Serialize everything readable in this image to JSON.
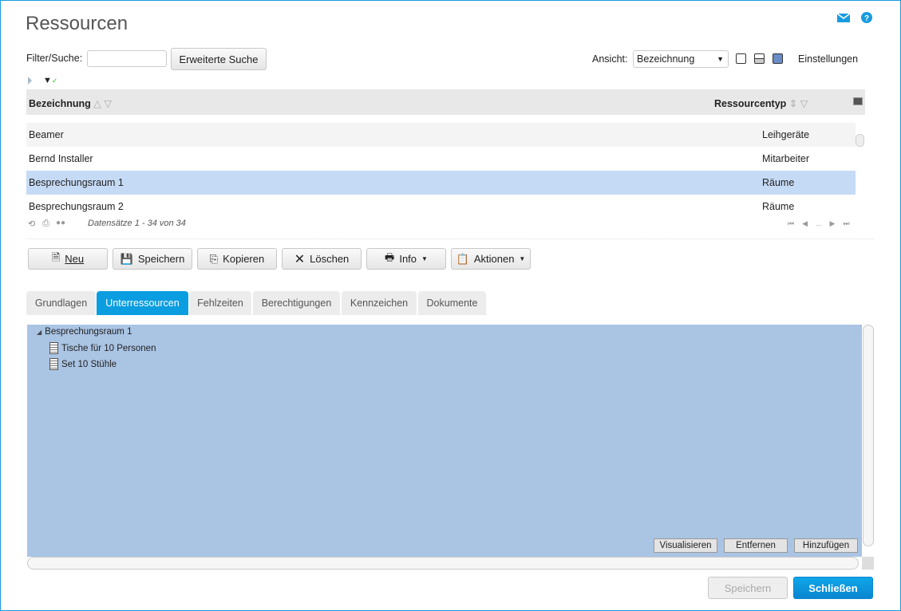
{
  "header": {
    "title": "Ressourcen",
    "mail_icon": "mail-icon",
    "help_icon": "help-icon"
  },
  "filter": {
    "label": "Filter/Suche:",
    "value": "",
    "advanced_search": "Erweiterte Suche"
  },
  "view": {
    "label": "Ansicht:",
    "selected": "Bezeichnung",
    "settings": "Einstellungen"
  },
  "table": {
    "columns": [
      "Bezeichnung",
      "Ressourcentyp"
    ],
    "rows": [
      {
        "name": "Beamer",
        "type": "Leihgeräte"
      },
      {
        "name": "Bernd Installer",
        "type": "Mitarbeiter"
      },
      {
        "name": "Besprechungsraum 1",
        "type": "Räume",
        "selected": true
      },
      {
        "name": "Besprechungsraum 2",
        "type": "Räume"
      }
    ],
    "records": "Datensätze 1 - 34 von 34",
    "pager_ellipsis": "..."
  },
  "toolbar": {
    "new": "Neu",
    "save": "Speichern",
    "copy": "Kopieren",
    "delete": "Löschen",
    "info": "Info",
    "actions": "Aktionen"
  },
  "tabs": [
    "Grundlagen",
    "Unterressourcen",
    "Fehlzeiten",
    "Berechtigungen",
    "Kennzeichen",
    "Dokumente"
  ],
  "tree": {
    "root": "Besprechungsraum 1",
    "children": [
      "Tische für 10 Personen",
      "Set 10 Stühle"
    ]
  },
  "panel_buttons": {
    "visualize": "Visualisieren",
    "remove": "Entfernen",
    "add": "Hinzufügen"
  },
  "footer": {
    "save": "Speichern",
    "close": "Schließen"
  },
  "colors": {
    "accent": "#0a9de0",
    "selected_row": "#c5daf5",
    "panel": "#aac4e4"
  }
}
